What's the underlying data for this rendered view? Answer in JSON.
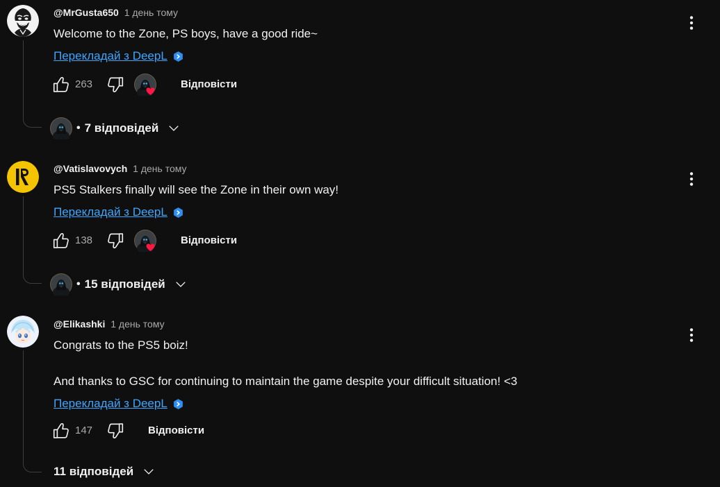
{
  "comments": [
    {
      "author": "@MrGusta650",
      "time": "1 день тому",
      "text": [
        "Welcome to the Zone, PS boys, have a good ride~"
      ],
      "translate": "Перекладай з DeepL",
      "likes": "263",
      "reply": "Відповісти",
      "hearted": true,
      "replies_count": "7 відповідей",
      "replies_dot": "•"
    },
    {
      "author": "@Vatislavovych",
      "time": "1 день тому",
      "text": [
        "PS5 Stalkers finally will see the Zone in their own way!"
      ],
      "translate": "Перекладай з DeepL",
      "likes": "138",
      "reply": "Відповісти",
      "hearted": true,
      "replies_count": "15 відповідей",
      "replies_dot": "•"
    },
    {
      "author": "@Elikashki",
      "time": "1 день тому",
      "text": [
        "Congrats to the PS5 boiz!",
        "And thanks to GSC for continuing to maintain the game despite your difficult situation! <3"
      ],
      "translate": "Перекладай з DeepL",
      "likes": "147",
      "reply": "Відповісти",
      "hearted": false,
      "replies_count": "11 відповідей"
    }
  ],
  "colors": {
    "background": "#0f0f0f",
    "text": "#f1f1f1",
    "muted": "#aaaaaa",
    "link": "#3ea6ff",
    "heart": "#ff1744",
    "thread_line": "#3d3d3d"
  },
  "icons": {
    "like": "thumb-up-icon",
    "dislike": "thumb-down-icon",
    "menu": "more-vert-icon",
    "chevron": "chevron-down-icon",
    "deepl": "deepl-badge-icon",
    "heart": "creator-heart-icon"
  }
}
